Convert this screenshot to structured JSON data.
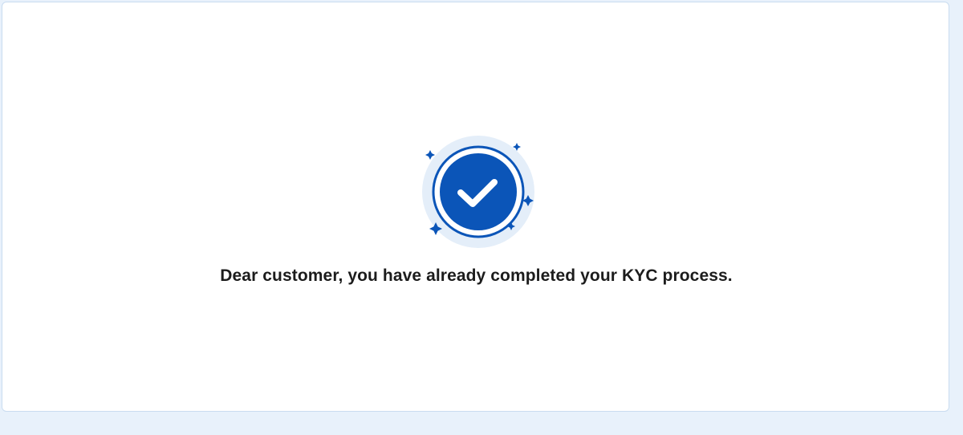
{
  "status": {
    "message": "Dear customer, you have already completed your KYC process.",
    "icon": "verified-check-icon"
  },
  "colors": {
    "page_background": "#e8f1fb",
    "card_background": "#ffffff",
    "accent": "#0b55b8",
    "halo": "#e4eef9",
    "text": "#1c1c1c"
  }
}
